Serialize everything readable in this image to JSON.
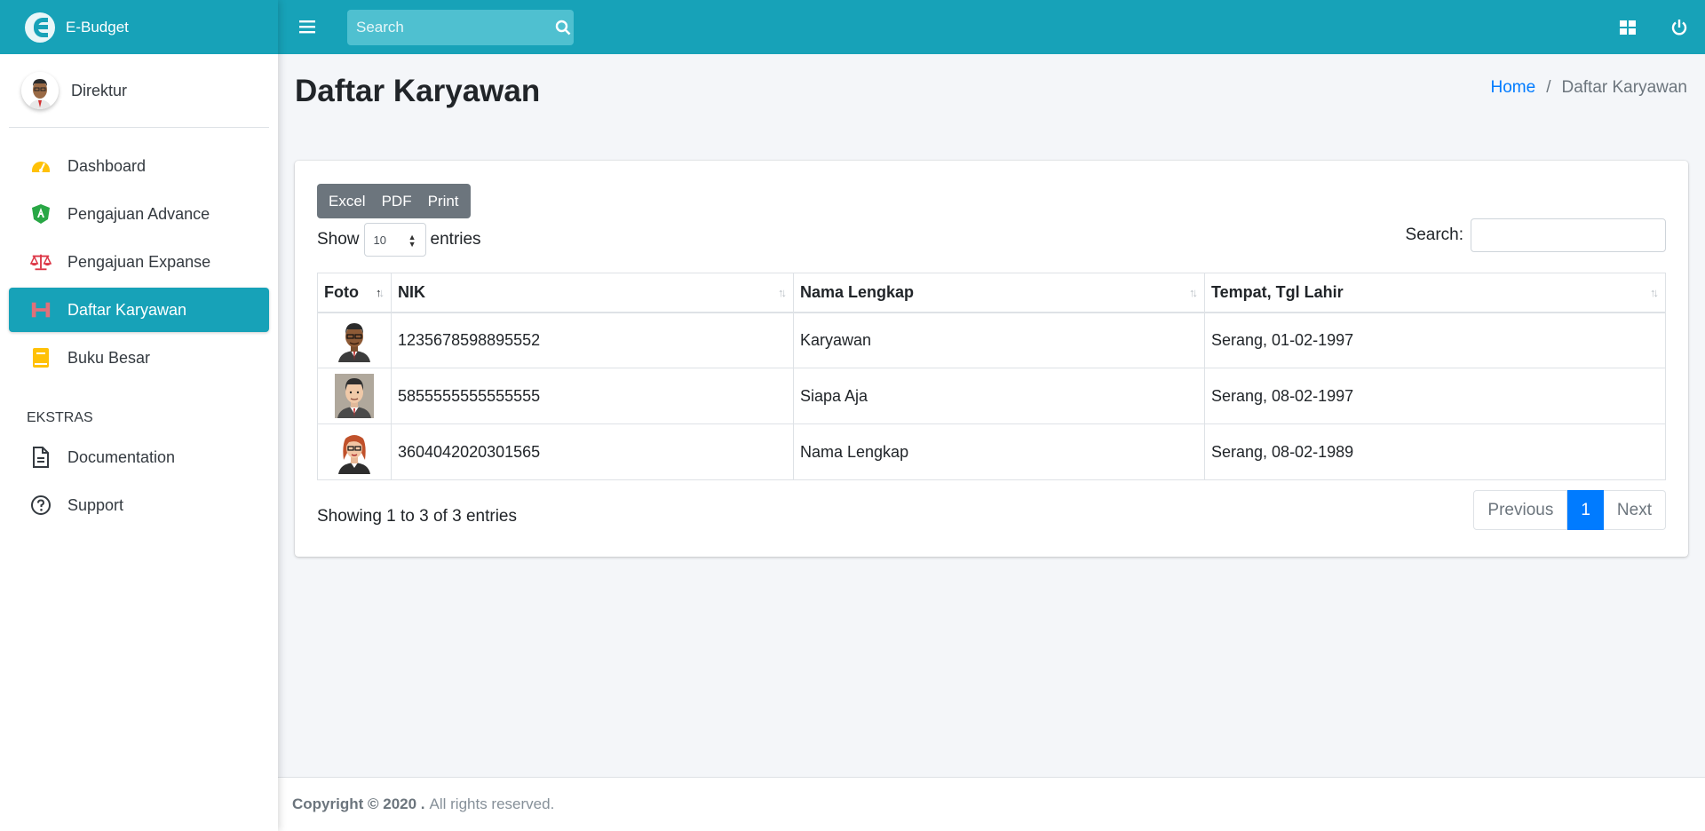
{
  "app": {
    "brand": "E-Budget"
  },
  "user": {
    "name": "Direktur"
  },
  "sidebar": {
    "items": [
      {
        "label": "Dashboard",
        "icon": "tachometer-icon",
        "color": "#ffc107"
      },
      {
        "label": "Pengajuan Advance",
        "icon": "angular-shield-icon",
        "color": "#28a745"
      },
      {
        "label": "Pengajuan Expanse",
        "icon": "balance-scale-icon",
        "color": "#dc3545"
      },
      {
        "label": "Daftar Karyawan",
        "icon": "users-icon",
        "color": "#ffffff",
        "active": true
      },
      {
        "label": "Buku Besar",
        "icon": "book-icon",
        "color": "#ffc107"
      }
    ],
    "header": "EKSTRAS",
    "extras": [
      {
        "label": "Documentation",
        "icon": "file-icon"
      },
      {
        "label": "Support",
        "icon": "question-circle-icon"
      }
    ]
  },
  "topbar": {
    "search_placeholder": "Search"
  },
  "page": {
    "title": "Daftar Karyawan",
    "breadcrumb_home": "Home",
    "breadcrumb_sep": "/",
    "breadcrumb_current": "Daftar Karyawan"
  },
  "table_controls": {
    "buttons": [
      "Excel",
      "PDF",
      "Print"
    ],
    "show_label": "Show",
    "length_value": "10",
    "entries_label": "entries",
    "search_label": "Search:"
  },
  "table": {
    "columns": [
      "Foto",
      "NIK",
      "Nama Lengkap",
      "Tempat, Tgl Lahir"
    ],
    "rows": [
      {
        "nik": "1235678598895552",
        "nama": "Karyawan",
        "ttl": "Serang, 01-02-1997"
      },
      {
        "nik": "5855555555555555",
        "nama": "Siapa Aja",
        "ttl": "Serang, 08-02-1997"
      },
      {
        "nik": "3604042020301565",
        "nama": "Nama Lengkap",
        "ttl": "Serang, 08-02-1989"
      }
    ]
  },
  "pagination": {
    "info": "Showing 1 to 3 of 3 entries",
    "previous": "Previous",
    "current": "1",
    "next": "Next"
  },
  "footer": {
    "copyright": "Copyright © 2020 .",
    "rights": "All rights reserved."
  },
  "colors": {
    "primary": "#17a2b8",
    "link": "#007bff",
    "button_gray": "#6c757d"
  }
}
